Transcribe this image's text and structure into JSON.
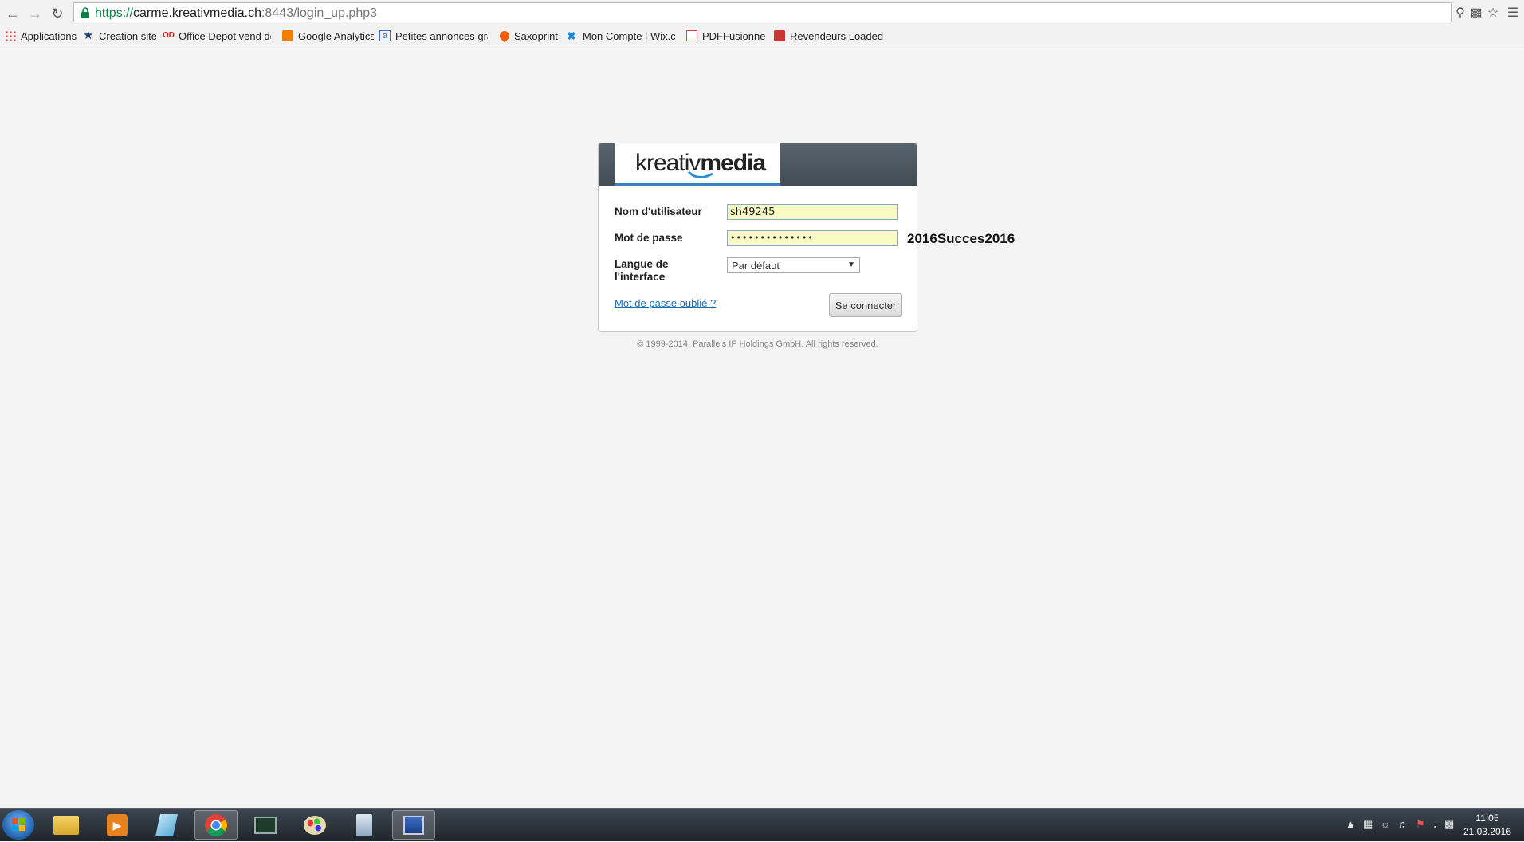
{
  "browser": {
    "url_scheme": "https://",
    "url_host": "carme.kreativmedia.ch",
    "url_rest": ":8443/login_up.php3"
  },
  "bookmarks": [
    {
      "label": "Applications",
      "icon": "apps-grid-icon"
    },
    {
      "label": "Creation site",
      "icon": "star-icon"
    },
    {
      "label": "Office Depot vend de",
      "icon": "office-depot-icon"
    },
    {
      "label": "Google Analytics",
      "icon": "analytics-icon"
    },
    {
      "label": "Petites annonces grat",
      "icon": "anibis-icon"
    },
    {
      "label": "Saxoprint",
      "icon": "drop-icon"
    },
    {
      "label": "Mon Compte | Wix.co",
      "icon": "wix-icon"
    },
    {
      "label": "PDFFusionner!",
      "icon": "pdf-icon"
    },
    {
      "label": "Revendeurs Loaded E",
      "icon": "map-pin-icon"
    }
  ],
  "login": {
    "logo_light": "kreativ",
    "logo_bold": "media",
    "username_label": "Nom d'utilisateur",
    "username_value": "sh49245",
    "password_label": "Mot de passe",
    "password_value": "••••••••••••••",
    "language_label_1": "Langue de",
    "language_label_2": "l'interface",
    "language_value": "Par défaut",
    "forgot_link": "Mot de passe oublié ?",
    "submit_label": "Se connecter",
    "copyright": "© 1999-2014. Parallels IP Holdings GmbH. All rights reserved."
  },
  "annotation": "2016Succes2016",
  "taskbar": {
    "time": "11:05",
    "date": "21.03.2016"
  },
  "colors": {
    "panel_header": "#4a545d",
    "autofill": "#fafac4",
    "link": "#1a6ab4",
    "logo_accent": "#3f7fbe"
  }
}
